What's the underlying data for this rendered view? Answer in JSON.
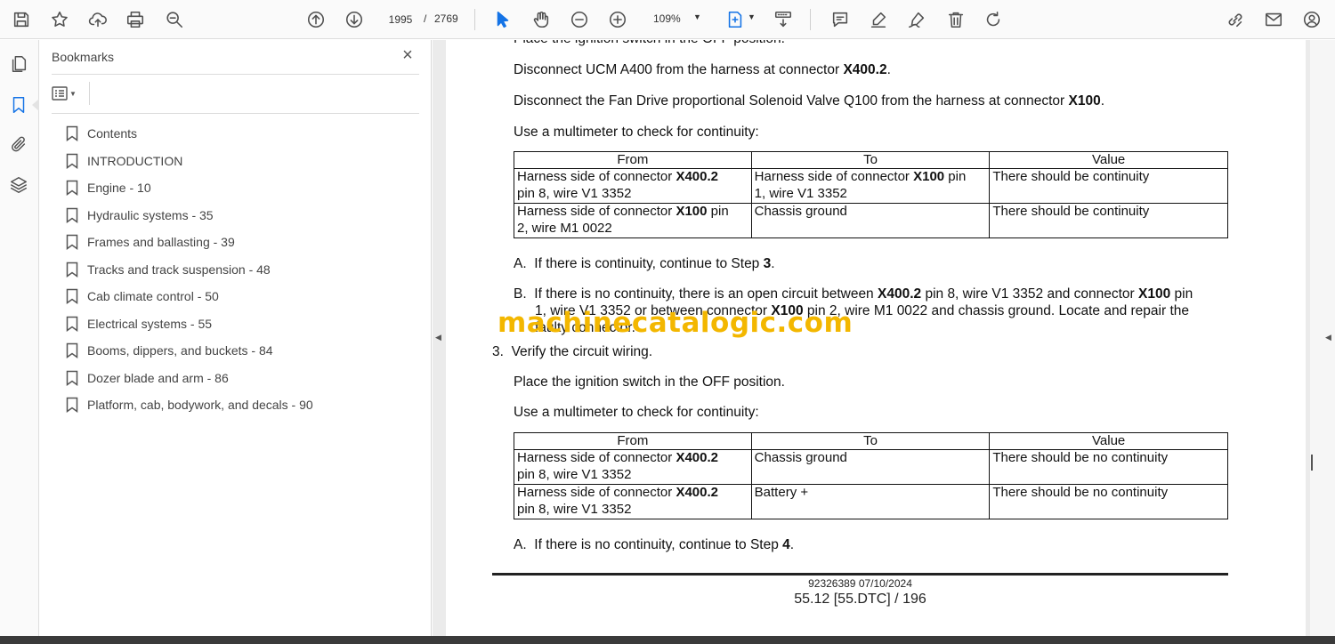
{
  "toolbar": {
    "page_current": "1995",
    "page_sep": "/",
    "page_total": "2769",
    "zoom": "109%"
  },
  "bookmarks": {
    "title": "Bookmarks",
    "close_glyph": "×",
    "items": [
      {
        "label": "Contents"
      },
      {
        "label": "INTRODUCTION"
      },
      {
        "label": "Engine - 10"
      },
      {
        "label": "Hydraulic systems - 35"
      },
      {
        "label": "Frames and ballasting - 39"
      },
      {
        "label": "Tracks and track suspension - 48"
      },
      {
        "label": "Cab climate control - 50"
      },
      {
        "label": "Electrical systems - 55"
      },
      {
        "label": "Booms, dippers, and buckets - 84"
      },
      {
        "label": "Dozer blade and arm - 86"
      },
      {
        "label": "Platform, cab, bodywork, and decals - 90"
      }
    ]
  },
  "document": {
    "cut_line": "Place the ignition switch in the OFF position.",
    "p1_pre": "Disconnect UCM A400 from the harness at connector ",
    "p1_bold": "X400.2",
    "p1_post": ".",
    "p2_pre": "Disconnect the Fan Drive proportional Solenoid Valve Q100 from the harness at connector ",
    "p2_bold": "X100",
    "p2_post": ".",
    "p3": "Use a multimeter to check for continuity:",
    "table_headers": {
      "from": "From",
      "to": "To",
      "value": "Value"
    },
    "table1": {
      "r1": {
        "from_pre": "Harness side of connector ",
        "from_bold": "X400.2",
        "from_l2": "pin 8, wire V1 3352",
        "to_pre": "Harness side of connector ",
        "to_bold": "X100",
        "to_post": " pin",
        "to_l2": "1, wire V1 3352",
        "value": "There should be continuity"
      },
      "r2": {
        "from_pre": "Harness side of connector ",
        "from_bold": "X100",
        "from_post": " pin",
        "from_l2": "2, wire M1 0022",
        "to": "Chassis ground",
        "value": "There should be continuity"
      }
    },
    "stepA1_letter": "A.",
    "stepA1_pre": "If there is continuity, continue to Step ",
    "stepA1_bold": "3",
    "stepA1_post": ".",
    "stepB1_letter": "B.",
    "stepB1_l1_a": "If there is no continuity, there is an open circuit between ",
    "stepB1_l1_b1": "X400.2",
    "stepB1_l1_c": " pin 8, wire V1 3352 and connector ",
    "stepB1_l1_b2": "X100",
    "stepB1_l1_d": " pin",
    "stepB1_l2_a": "1, wire V1 3352 or between connector ",
    "stepB1_l2_b": "X100",
    "stepB1_l2_c": " pin 2, wire M1 0022 and chassis ground.  Locate and repair the",
    "stepB1_l3": "faulty connector.",
    "step3_num": "3.",
    "step3_text": "Verify the circuit wiring.",
    "p4": "Place the ignition switch in the OFF position.",
    "p5": "Use a multimeter to check for continuity:",
    "table2": {
      "r1": {
        "from_pre": "Harness side of connector ",
        "from_bold": "X400.2",
        "from_l2": "pin 8, wire V1 3352",
        "to": "Chassis ground",
        "value": "There should be no continuity"
      },
      "r2": {
        "from_pre": "Harness side of connector ",
        "from_bold": "X400.2",
        "from_l2": "pin 8, wire V1 3352",
        "to": "Battery +",
        "value": "There should be no continuity"
      }
    },
    "stepA2_letter": "A.",
    "stepA2_pre": "If there is no continuity, continue to Step ",
    "stepA2_bold": "4",
    "stepA2_post": ".",
    "footer_id": "92326389 07/10/2024",
    "footer_page": "55.12 [55.DTC] / 196"
  },
  "watermark": "machinecatalogic.com",
  "colors": {
    "accent": "#1473e6",
    "watermark": "#f3b700"
  }
}
